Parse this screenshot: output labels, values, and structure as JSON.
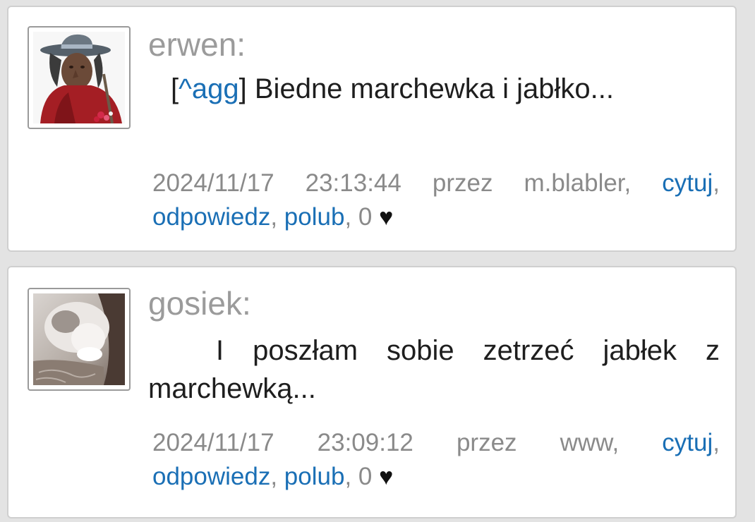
{
  "comments": [
    {
      "author": "erwen:",
      "avatar": "witch-figurine-avatar",
      "reply_tag_open": "[",
      "reply_tag_link": "^agg",
      "reply_tag_close": "]",
      "text": " Biedne marchewka i jabłko...",
      "date": "2024/11/17",
      "time": "23:13:44",
      "by_label": "przez",
      "by_user": "m.blabler,",
      "quote": "cytuj",
      "reply": "odpowiedz",
      "like": "polub",
      "likes": "0",
      "heart": "♥"
    },
    {
      "author": "gosiek:",
      "avatar": "cat-avatar",
      "text": "I poszłam sobie zetrzeć jabłek z marchewką...",
      "date": "2024/11/17",
      "time": "23:09:12",
      "by_label": "przez",
      "by_user": "www,",
      "quote": "cytuj",
      "reply": "odpowiedz",
      "like": "polub",
      "likes": "0",
      "heart": "♥"
    }
  ],
  "colors": {
    "link": "#1a6fb5",
    "author": "#9b9b9b",
    "meta": "#8a8a8a",
    "background": "#e3e3e3"
  }
}
